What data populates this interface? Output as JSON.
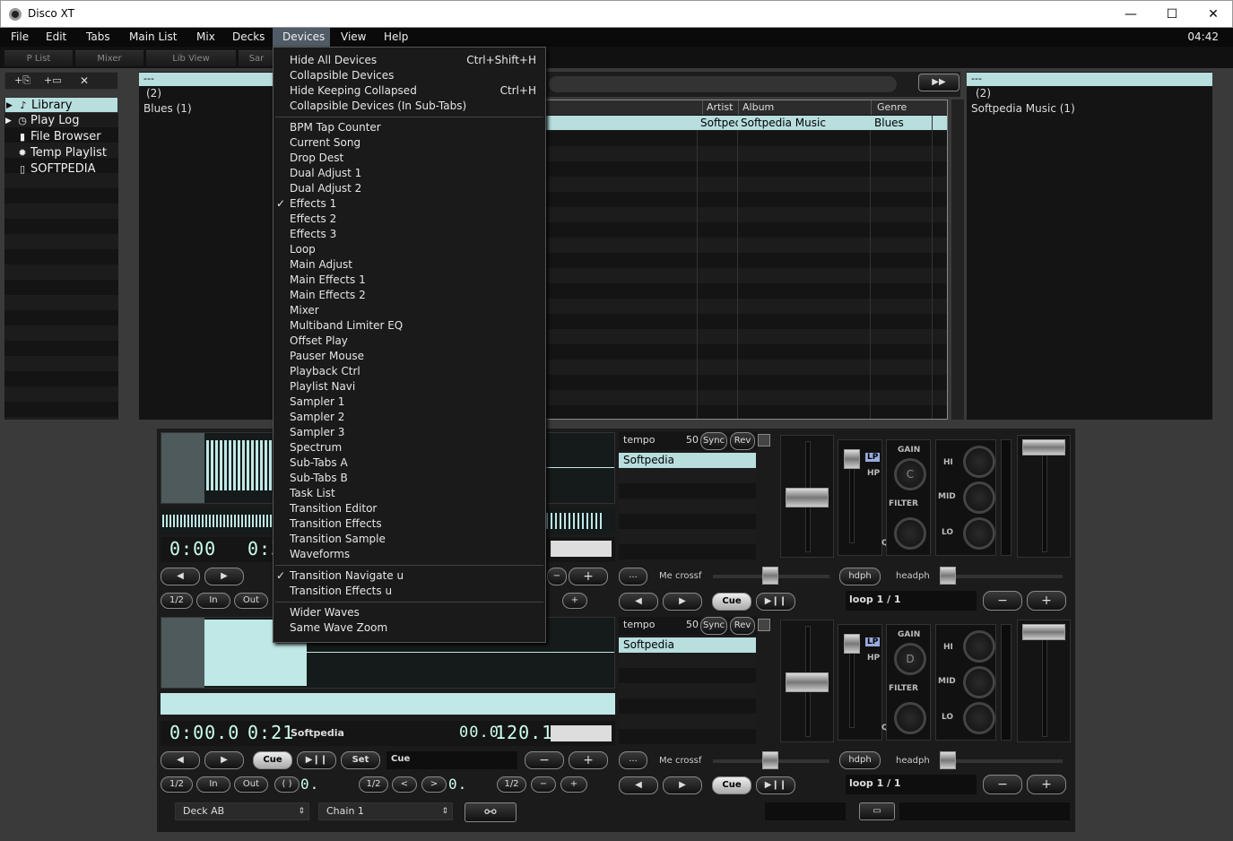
{
  "app": {
    "title": "Disco XT",
    "clock": "04:42"
  },
  "window": {
    "min": "—",
    "max": "☐",
    "close": "✕"
  },
  "menubar": [
    "File",
    "Edit",
    "Tabs",
    "Main List",
    "Mix",
    "Decks",
    "Devices",
    "View",
    "Help"
  ],
  "tabs": [
    "P List",
    "Mixer",
    "Lib View",
    "Sar"
  ],
  "toolbar": {
    "add_list": "+⎘",
    "add_folder": "+▭",
    "remove": "✕"
  },
  "tree": [
    {
      "label": "Library",
      "icon": "♪",
      "arrow": "▶",
      "selected": true
    },
    {
      "label": "Play Log",
      "icon": "◷",
      "arrow": "▶"
    },
    {
      "label": "File Browser",
      "icon": "▮",
      "arrow": ""
    },
    {
      "label": "Temp Playlist",
      "icon": "✹",
      "arrow": ""
    },
    {
      "label": "SOFTPEDIA",
      "icon": "▯",
      "arrow": ""
    }
  ],
  "left_panel": {
    "header": "---",
    "count": "(2)",
    "item": "Blues (1)"
  },
  "right_panel": {
    "header": "---",
    "count": "(2)",
    "item": "Softpedia Music (1)"
  },
  "ff_button": "▶▶",
  "table": {
    "columns": [
      "Artist",
      "Album",
      "Genre"
    ],
    "row": {
      "artist": "Softpec",
      "album": "Softpedia Music",
      "genre": "Blues"
    }
  },
  "menu": {
    "groups": [
      [
        {
          "label": "Hide All Devices",
          "shortcut": "Ctrl+Shift+H"
        },
        {
          "label": "Collapsible Devices"
        },
        {
          "label": "Hide Keeping Collapsed",
          "shortcut": "Ctrl+H"
        },
        {
          "label": "Collapsible Devices (In Sub-Tabs)"
        }
      ],
      [
        {
          "label": "BPM Tap Counter"
        },
        {
          "label": "Current Song"
        },
        {
          "label": "Drop Dest"
        },
        {
          "label": "Dual Adjust 1"
        },
        {
          "label": "Dual Adjust 2"
        },
        {
          "label": "Effects 1",
          "checked": true
        },
        {
          "label": "Effects 2"
        },
        {
          "label": "Effects 3"
        },
        {
          "label": "Loop"
        },
        {
          "label": "Main Adjust"
        },
        {
          "label": "Main Effects 1"
        },
        {
          "label": "Main Effects 2"
        },
        {
          "label": "Mixer"
        },
        {
          "label": "Multiband Limiter EQ"
        },
        {
          "label": "Offset Play"
        },
        {
          "label": "Pauser Mouse"
        },
        {
          "label": "Playback Ctrl"
        },
        {
          "label": "Playlist Navi"
        },
        {
          "label": "Sampler 1"
        },
        {
          "label": "Sampler 2"
        },
        {
          "label": "Sampler 3"
        },
        {
          "label": "Spectrum"
        },
        {
          "label": "Sub-Tabs A"
        },
        {
          "label": "Sub-Tabs B"
        },
        {
          "label": "Task List"
        },
        {
          "label": "Transition Editor"
        },
        {
          "label": "Transition Effects"
        },
        {
          "label": "Transition Sample"
        },
        {
          "label": "Waveforms"
        }
      ],
      [
        {
          "label": "Transition Navigate u",
          "checked": true
        },
        {
          "label": "Transition Effects u"
        }
      ],
      [
        {
          "label": "Wider Waves"
        },
        {
          "label": "Same Wave Zoom"
        }
      ]
    ]
  },
  "deck_top": {
    "time1": "0:00",
    "time2": "0:3",
    "tempo_label": "tempo",
    "tempo_value": "50",
    "sync": "Sync",
    "rev": "Rev",
    "playlist_item": "Softpedia",
    "mecrossf": "Me crossf",
    "hdph": "hdph",
    "headph": "headph",
    "loop": "loop 1 / 1",
    "btn_half": "1/2",
    "btn_in": "In",
    "btn_out": "Out",
    "knob_letter": "C"
  },
  "deck_bottom": {
    "time1": "0:00.0",
    "time2": "0:21",
    "title": "Softpedia",
    "pos": "00.0",
    "bpm": "120.1",
    "cue_label": "Cue",
    "set_label": "Set",
    "cue_text": "Cue",
    "tempo_label": "tempo",
    "tempo_value": "50",
    "sync": "Sync",
    "rev": "Rev",
    "playlist_item": "Softpedia",
    "mecrossf": "Me crossf",
    "hdph": "hdph",
    "headph": "headph",
    "loop": "loop 1 / 1",
    "btn_half": "1/2",
    "btn_in": "In",
    "btn_out": "Out",
    "paren": "( )",
    "zero": "0.",
    "knob_letter": "D"
  },
  "mixer_labels": {
    "gain": "GAIN",
    "filter": "FILTER",
    "hi": "HI",
    "mid": "MID",
    "lo": "LO",
    "lp": "LP",
    "hp": "HP",
    "q": "Q"
  },
  "transport": {
    "prev": "◀",
    "next": "▶",
    "play": "▶❙❙",
    "cue": "Cue",
    "minus": "−",
    "plus": "+",
    "dots": "...",
    "lt": "<",
    "gt": ">"
  },
  "bottom_bar": {
    "deck_select": "Deck AB",
    "chain_select": "Chain 1",
    "folder": "▭",
    "link": "⚯"
  }
}
